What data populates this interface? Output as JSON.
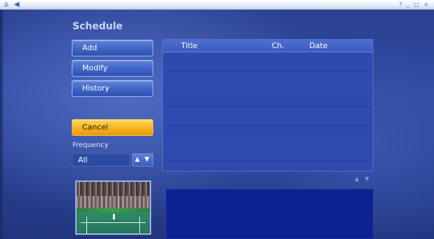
{
  "topbar": {
    "home_icon": "home-icon",
    "back_icon": "back-arrow-icon",
    "controls": "? _ □ ×"
  },
  "page": {
    "title": "Schedule"
  },
  "actions": {
    "add": "Add",
    "modify": "Modify",
    "history": "History",
    "cancel": "Cancel"
  },
  "frequency": {
    "label": "Frequency",
    "value": "All",
    "arrows": "▲ ▼"
  },
  "list": {
    "columns": {
      "title": "Title",
      "channel": "Ch.",
      "date": "Date"
    },
    "rows": [],
    "scroll_arrows": "▲ ▼"
  },
  "preview": {
    "content": "tennis-match-thumbnail"
  },
  "colors": {
    "accent_button": "#4a6fd1",
    "cancel_button": "#f7b21d",
    "panel": "#2f4bb0",
    "info_panel": "#0d2291"
  }
}
